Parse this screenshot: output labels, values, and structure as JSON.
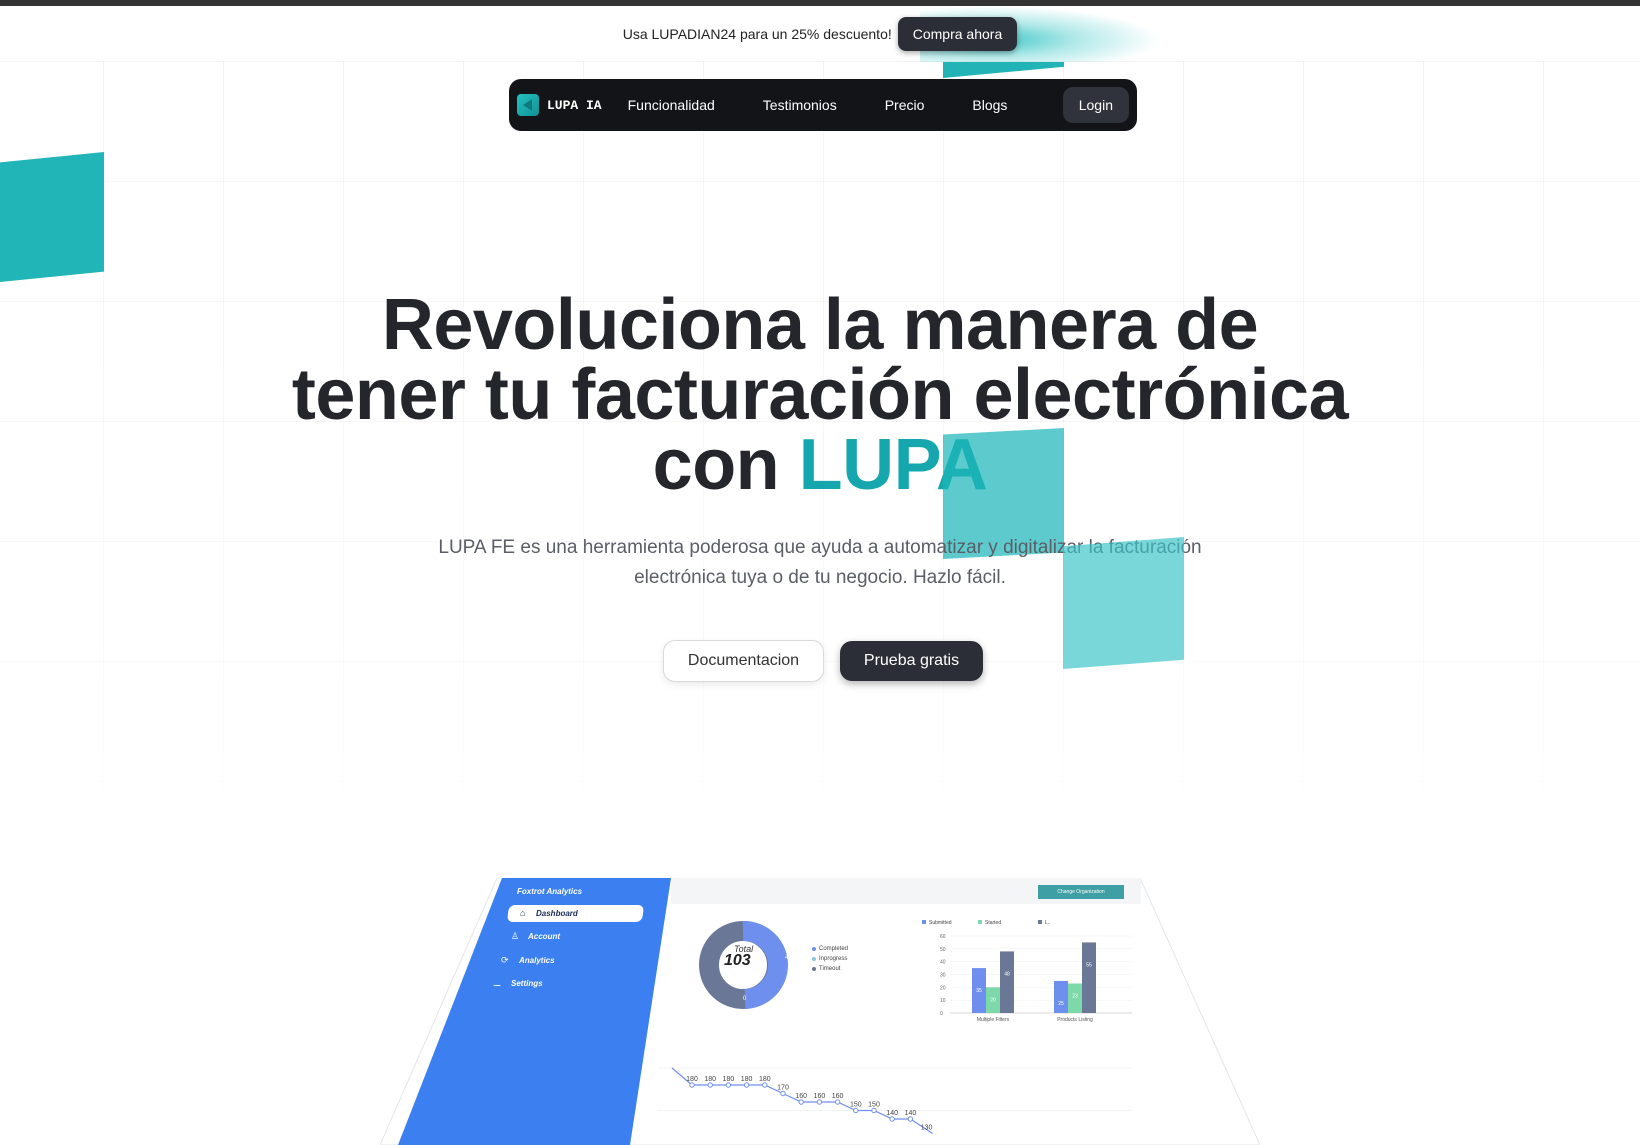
{
  "promo": {
    "text": "Usa LUPADIAN24 para un 25% descuento!",
    "button": "Compra ahora"
  },
  "nav": {
    "logo": "LUPA IA",
    "links": [
      "Funcionalidad",
      "Testimonios",
      "Precio",
      "Blogs"
    ],
    "login": "Login"
  },
  "hero": {
    "title_line1": "Revoluciona la manera de",
    "title_line2": "tener tu facturación electrónica",
    "title_line3_pre": "con ",
    "title_line3_accent": "LUPA",
    "subtitle_line1": "LUPA FE es una herramienta poderosa que ayuda a automatizar y digitalizar la facturación",
    "subtitle_line2": "electrónica tuya o de tu negocio. Hazlo fácil.",
    "btn_docs": "Documentacion",
    "btn_trial": "Prueba gratis"
  },
  "colors": {
    "accent": "#15a7ad",
    "dark": "#131418",
    "sidebar": "#3b7ff0"
  },
  "dashboard": {
    "brand": "Foxtrot Analytics",
    "org_button": "Change Organization",
    "nav": [
      "Dashboard",
      "Account",
      "Analytics",
      "Settings"
    ],
    "donut": {
      "total_label": "Total",
      "total_value": "103",
      "values": {
        "left": "54",
        "right": "49",
        "bottom": "0"
      },
      "legend": [
        "Completed",
        "Inprogress",
        "Timeout"
      ]
    },
    "bar_legend": [
      "Submitted",
      "Started",
      "L.."
    ]
  },
  "chart_data": [
    {
      "type": "bar",
      "categories": [
        "Multiple Filters",
        "Products Listing"
      ],
      "series": [
        {
          "name": "Submitted",
          "values": [
            35,
            25
          ]
        },
        {
          "name": "Started",
          "values": [
            20,
            23
          ]
        },
        {
          "name": "",
          "values": [
            48,
            55
          ]
        }
      ],
      "ylim": [
        0,
        60
      ],
      "yticks": [
        0,
        10,
        20,
        30,
        40,
        50,
        60
      ],
      "bar_labels": [
        "35",
        "20",
        "48",
        "25",
        "23",
        "55"
      ]
    },
    {
      "type": "line",
      "x": [
        1,
        2,
        3,
        4,
        5,
        6,
        7,
        8,
        9,
        10,
        11,
        12,
        13
      ],
      "values": [
        180,
        180,
        180,
        180,
        180,
        170,
        160,
        160,
        160,
        150,
        150,
        140,
        140
      ],
      "last_partial": 130,
      "ylim": [
        130,
        200
      ],
      "yticks": [
        200,
        150
      ]
    }
  ]
}
